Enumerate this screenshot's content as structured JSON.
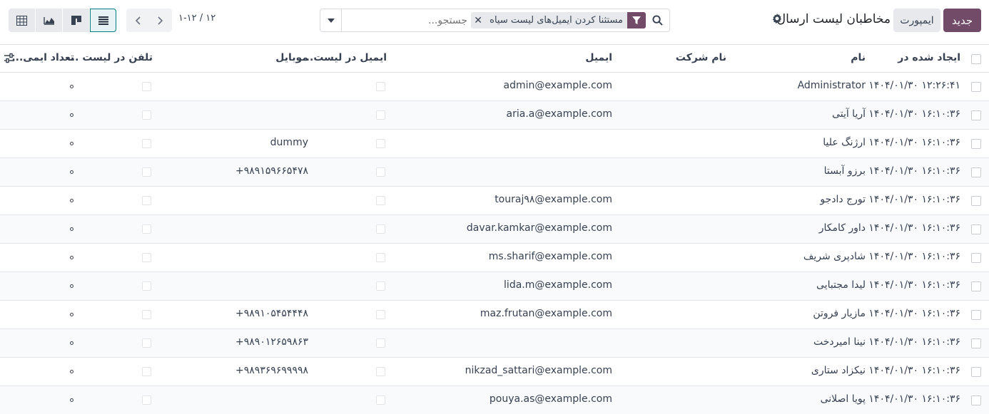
{
  "control_panel": {
    "new_label": "جدید",
    "import_label": "ایمپورت",
    "title": "مخاطبان لیست ارسال",
    "search": {
      "facet_label": "مستثنا کردن ایمیل‌های لیست سیاه",
      "placeholder": "جستجو..."
    },
    "pager": {
      "value": "۱-۱۲ / ۱۲"
    },
    "views": [
      "list-view",
      "kanban-view",
      "graph-view",
      "pivot-view"
    ],
    "active_view": "list-view"
  },
  "table": {
    "headers": {
      "created_on": "ایجاد شده در",
      "name": "نام",
      "company": "نام شرکت",
      "email": "ایمیل",
      "email_blacklist": "ایمیل در لیست...",
      "mobile": "موبایل",
      "phone_blacklist": "تلفن در لیست ...",
      "bounce": "تعداد ایمی..."
    },
    "rows": [
      {
        "created": "۱۴۰۴/۰۱/۳۰ ۱۲:۲۶:۴۱",
        "name": "Administrator",
        "company": "",
        "email": "admin@example.com",
        "mobile": "",
        "bounce": "۰"
      },
      {
        "created": "۱۴۰۴/۰۱/۳۰ ۱۶:۱۰:۳۶",
        "name": "آریا آیتی",
        "company": "",
        "email": "aria.a@example.com",
        "mobile": "",
        "bounce": "۰"
      },
      {
        "created": "۱۴۰۴/۰۱/۳۰ ۱۶:۱۰:۳۶",
        "name": "ارژنگ علیا",
        "company": "",
        "email": "",
        "mobile": "dummy",
        "bounce": "۰"
      },
      {
        "created": "۱۴۰۴/۰۱/۳۰ ۱۶:۱۰:۳۶",
        "name": "برزو آبستا",
        "company": "",
        "email": "",
        "mobile": "+۹۸۹۱۵۹۶۶۵۴۷۸",
        "bounce": "۰"
      },
      {
        "created": "۱۴۰۴/۰۱/۳۰ ۱۶:۱۰:۳۶",
        "name": "تورج دادجو",
        "company": "",
        "email": "touraj۹۸@example.com",
        "mobile": "",
        "bounce": "۰"
      },
      {
        "created": "۱۴۰۴/۰۱/۳۰ ۱۶:۱۰:۳۶",
        "name": "داور کامکار",
        "company": "",
        "email": "davar.kamkar@example.com",
        "mobile": "",
        "bounce": "۰"
      },
      {
        "created": "۱۴۰۴/۰۱/۳۰ ۱۶:۱۰:۳۶",
        "name": "شادپری شریف",
        "company": "",
        "email": "ms.sharif@example.com",
        "mobile": "",
        "bounce": "۰"
      },
      {
        "created": "۱۴۰۴/۰۱/۳۰ ۱۶:۱۰:۳۶",
        "name": "لیدا مجتبایی",
        "company": "",
        "email": "lida.m@example.com",
        "mobile": "",
        "bounce": "۰"
      },
      {
        "created": "۱۴۰۴/۰۱/۳۰ ۱۶:۱۰:۳۶",
        "name": "مازیار فروتن",
        "company": "",
        "email": "maz.frutan@example.com",
        "mobile": "+۹۸۹۱۰۵۴۵۴۴۴۸",
        "bounce": "۰"
      },
      {
        "created": "۱۴۰۴/۰۱/۳۰ ۱۶:۱۰:۳۶",
        "name": "نینا امیردخت",
        "company": "",
        "email": "",
        "mobile": "+۹۸۹۰۱۲۶۵۹۸۶۳",
        "bounce": "۰"
      },
      {
        "created": "۱۴۰۴/۰۱/۳۰ ۱۶:۱۰:۳۶",
        "name": "نیکزاد ستاری",
        "company": "",
        "email": "nikzad_sattari@example.com",
        "mobile": "+۹۸۹۳۶۹۶۹۹۹۹۸",
        "bounce": "۰"
      },
      {
        "created": "۱۴۰۴/۰۱/۳۰ ۱۶:۱۰:۳۶",
        "name": "پویا اصلانی",
        "company": "",
        "email": "pouya.as@example.com",
        "mobile": "",
        "bounce": "۰"
      }
    ]
  },
  "colors": {
    "primary": "#714b67",
    "active_view": "#017e84"
  }
}
